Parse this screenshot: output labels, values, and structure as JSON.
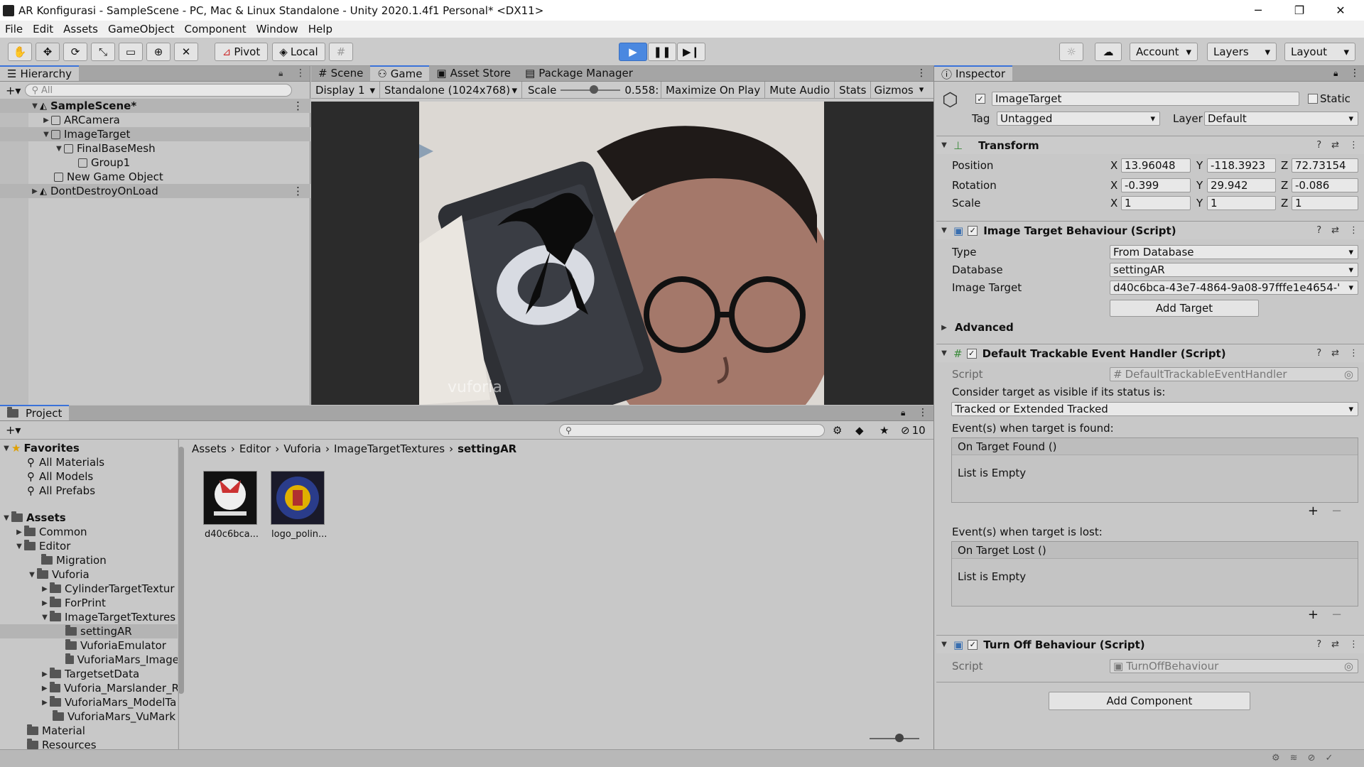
{
  "window": {
    "title": "AR Konfigurasi - SampleScene - PC, Mac & Linux Standalone - Unity 2020.1.4f1 Personal* <DX11>"
  },
  "menu": [
    "File",
    "Edit",
    "Assets",
    "GameObject",
    "Component",
    "Window",
    "Help"
  ],
  "toolbar": {
    "pivot": "Pivot",
    "local": "Local",
    "account": "Account",
    "layers": "Layers",
    "layout": "Layout"
  },
  "hierarchy": {
    "tab": "Hierarchy",
    "search_placeholder": "All",
    "items": [
      {
        "label": "SampleScene*"
      },
      {
        "label": "ARCamera"
      },
      {
        "label": "ImageTarget"
      },
      {
        "label": "FinalBaseMesh"
      },
      {
        "label": "Group1"
      },
      {
        "label": "New Game Object"
      },
      {
        "label": "DontDestroyOnLoad"
      }
    ]
  },
  "game": {
    "tabs": [
      "Scene",
      "Game",
      "Asset Store",
      "Package Manager"
    ],
    "display": "Display 1",
    "resolution": "Standalone (1024x768)",
    "scale_label": "Scale",
    "scale_value": "0.558:",
    "scale_fraction": 0.56,
    "maximize": "Maximize On Play",
    "mute": "Mute Audio",
    "stats": "Stats",
    "gizmos": "Gizmos",
    "watermark": "vuforia"
  },
  "project": {
    "tab": "Project",
    "hidden_count": "10",
    "favorites_label": "Favorites",
    "favorites": [
      "All Materials",
      "All Models",
      "All Prefabs"
    ],
    "assets_label": "Assets",
    "tree": [
      {
        "label": "Common"
      },
      {
        "label": "Editor"
      },
      {
        "label": "Migration"
      },
      {
        "label": "Vuforia"
      },
      {
        "label": "CylinderTargetTextur"
      },
      {
        "label": "ForPrint"
      },
      {
        "label": "ImageTargetTextures"
      },
      {
        "label": "settingAR"
      },
      {
        "label": "VuforiaEmulator"
      },
      {
        "label": "VuforiaMars_Image"
      },
      {
        "label": "TargetsetData"
      },
      {
        "label": "Vuforia_Marslander_R"
      },
      {
        "label": "VuforiaMars_ModelTa"
      },
      {
        "label": "VuforiaMars_VuMark"
      },
      {
        "label": "Material"
      },
      {
        "label": "Resources"
      }
    ],
    "breadcrumb": [
      "Assets",
      "Editor",
      "Vuforia",
      "ImageTargetTextures",
      "settingAR"
    ],
    "files": [
      {
        "label": "d40c6bca..."
      },
      {
        "label": "logo_polin..."
      }
    ]
  },
  "inspector": {
    "tab": "Inspector",
    "object_name": "ImageTarget",
    "static_label": "Static",
    "tag_label": "Tag",
    "tag_value": "Untagged",
    "layer_label": "Layer",
    "layer_value": "Default",
    "transform": {
      "title": "Transform",
      "position_label": "Position",
      "rotation_label": "Rotation",
      "scale_label": "Scale",
      "pos": {
        "x": "13.96048",
        "y": "-118.3923",
        "z": "72.73154"
      },
      "rot": {
        "x": "-0.399",
        "y": "29.942",
        "z": "-0.086"
      },
      "scl": {
        "x": "1",
        "y": "1",
        "z": "1"
      }
    },
    "itb": {
      "title": "Image Target Behaviour (Script)",
      "type_label": "Type",
      "type_value": "From Database",
      "db_label": "Database",
      "db_value": "settingAR",
      "target_label": "Image Target",
      "target_value": "d40c6bca-43e7-4864-9a08-97fffe1e4654-'",
      "add_target": "Add Target",
      "advanced": "Advanced"
    },
    "dteh": {
      "title": "Default Trackable Event Handler (Script)",
      "script_label": "Script",
      "script_value": "DefaultTrackableEventHandler",
      "consider": "Consider target as visible if its status is:",
      "status": "Tracked or Extended Tracked",
      "found_label": "Event(s) when target is found:",
      "found_event": "On Target Found ()",
      "lost_label": "Event(s) when target is lost:",
      "lost_event": "On Target Lost ()",
      "empty": "List is Empty"
    },
    "tob": {
      "title": "Turn Off Behaviour (Script)",
      "script_label": "Script",
      "script_value": "TurnOffBehaviour"
    },
    "add_component": "Add Component"
  }
}
